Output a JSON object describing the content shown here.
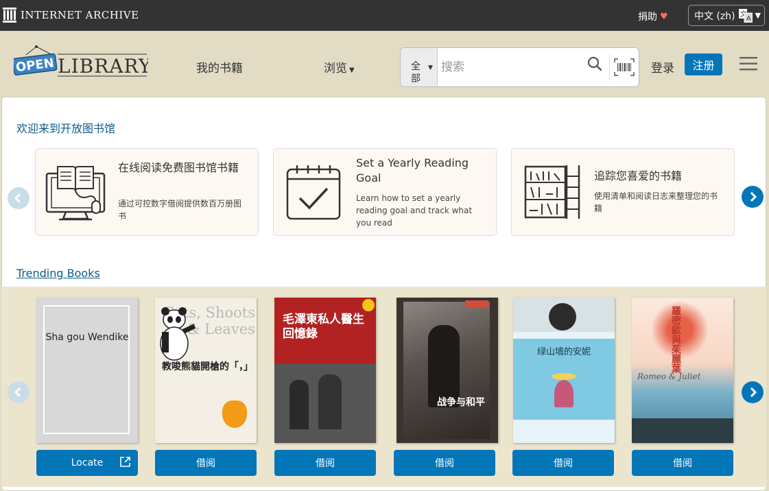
{
  "topbar": {
    "brand": "INTERNET ARCHIVE",
    "donate_label": "捐助",
    "language_label": "中文 (zh)"
  },
  "header": {
    "logo_open": "OPEN",
    "logo_library": "LIBRARY",
    "nav_my_books": "我的书籍",
    "nav_browse": "浏览",
    "search_scope": "全部",
    "search_placeholder": "搜索",
    "login_label": "登录",
    "signup_label": "注册"
  },
  "welcome": {
    "title": "欢迎来到开放图书馆",
    "cards": [
      {
        "title": "在线阅读免费图书馆书籍",
        "desc": "通过可控数字借阅提供数百万册图书",
        "icon": "computer-book-icon"
      },
      {
        "title": "Set a Yearly Reading Goal",
        "desc": "Learn how to set a yearly reading goal and track what you read",
        "icon": "calendar-check-icon"
      },
      {
        "title": "追踪您喜爱的书籍",
        "desc": "使用清单和阅读日志来整理您的书籍",
        "icon": "bookshelf-icon"
      }
    ]
  },
  "trending": {
    "title": "Trending Books",
    "books": [
      {
        "cover_text": "Sha gou Wendike",
        "button": "Locate"
      },
      {
        "cover_title": "Eats, Shoots & Leaves",
        "cover_text": "教唆熊貓開槍的「，」",
        "button": "借阅"
      },
      {
        "cover_text": "毛澤東私人醫生回憶錄",
        "button": "借阅"
      },
      {
        "cover_text": "战争与和平",
        "button": "借阅"
      },
      {
        "cover_text": "绿山墙的安妮",
        "button": "借阅"
      },
      {
        "cover_text": "羅密歐與茱麗葉",
        "cover_subtitle": "Romeo & Juliet",
        "button": "借阅"
      }
    ]
  },
  "colors": {
    "topbar": "#333333",
    "header_bg": "#e2dcc5",
    "primary_blue": "#0376b8",
    "link_blue": "#0a5b8d"
  }
}
